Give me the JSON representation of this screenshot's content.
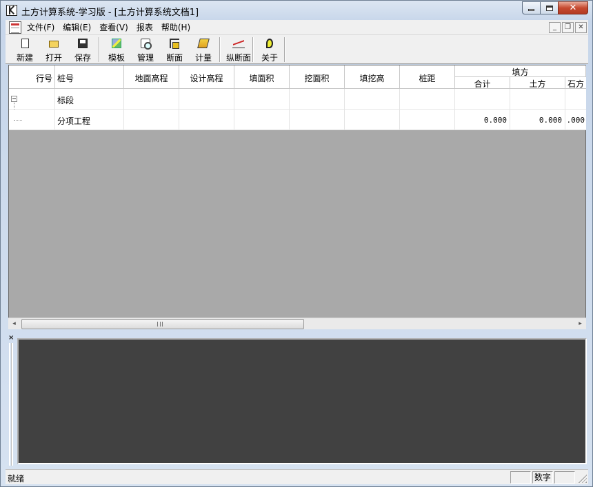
{
  "window": {
    "title": "土方计算系统-学习版 - [土方计算系统文档1]",
    "minimize_icon": "minimize-icon",
    "maximize_icon": "maximize-icon",
    "close_glyph": "✕"
  },
  "menubar": {
    "items": [
      {
        "label": "文件(F)"
      },
      {
        "label": "编辑(E)"
      },
      {
        "label": "查看(V)"
      },
      {
        "label": "报表"
      },
      {
        "label": "帮助(H)"
      }
    ],
    "mdi": {
      "minimize": "_",
      "restore": "❐",
      "close": "✕"
    }
  },
  "toolbar": {
    "buttons": [
      {
        "label": "新建",
        "icon": "new-file-icon"
      },
      {
        "label": "打开",
        "icon": "open-folder-icon"
      },
      {
        "label": "保存",
        "icon": "save-disk-icon"
      },
      {
        "label": "模板",
        "icon": "template-icon"
      },
      {
        "label": "管理",
        "icon": "manage-icon"
      },
      {
        "label": "断面",
        "icon": "cross-section-icon"
      },
      {
        "label": "计量",
        "icon": "measure-icon"
      },
      {
        "label": "纵断面",
        "icon": "profile-icon"
      },
      {
        "label": "关于",
        "icon": "about-icon"
      }
    ]
  },
  "grid": {
    "columns": {
      "row_no": "行号",
      "pile_no": "桩号",
      "ground_elev": "地面高程",
      "design_elev": "设计高程",
      "fill_area": "填面积",
      "cut_area": "挖面积",
      "fill_cut_height": "填挖高",
      "pile_dist": "桩距",
      "fill_group": "填方",
      "fill_total": "合计",
      "fill_earth": "土方",
      "fill_stone": "石方"
    },
    "rows": [
      {
        "pile_no": "标段",
        "fill_total": "",
        "fill_earth": "",
        "fill_stone": ""
      },
      {
        "pile_no": "分项工程",
        "fill_total": "0.000",
        "fill_earth": "0.000",
        "fill_stone": ".000"
      }
    ]
  },
  "scrollbar": {
    "left_arrow": "◂",
    "right_arrow": "▸"
  },
  "output_pane": {
    "close_glyph": "×"
  },
  "statusbar": {
    "text": "就绪",
    "panel_num": "数字"
  }
}
